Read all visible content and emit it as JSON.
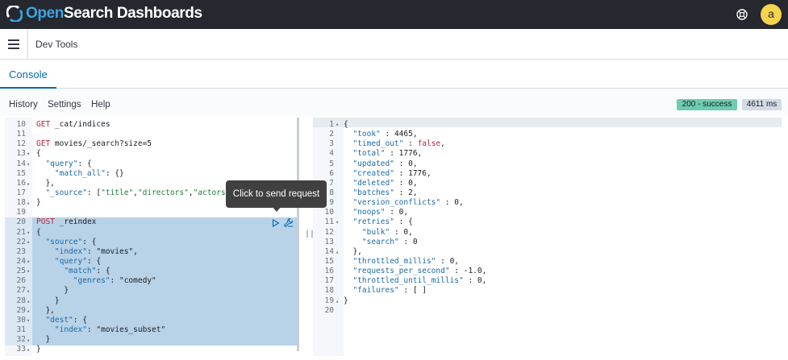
{
  "app": {
    "logo_open": "Open",
    "logo_rest": "Search Dashboards",
    "avatar_letter": "a",
    "help_icon": "help-ring-icon",
    "colors": {
      "topbar": "#25282f",
      "brand_blue": "#3ba4df",
      "avatar": "#f6d44d",
      "accent": "#006bb4"
    }
  },
  "subheader": {
    "breadcrumb": "Dev Tools"
  },
  "tabs": [
    {
      "label": "Console",
      "active": true
    }
  ],
  "menu": [
    "History",
    "Settings",
    "Help"
  ],
  "status": {
    "code_text": "200 - success",
    "time_text": "4611 ms",
    "success_color": "#6dccb1"
  },
  "tooltip": {
    "text": "Click to send request"
  },
  "request_lines": [
    {
      "n": "10",
      "f": "",
      "t": "GET _cat/indices"
    },
    {
      "n": "11",
      "f": "",
      "t": ""
    },
    {
      "n": "12",
      "f": "",
      "t": "GET movies/_search?size=5"
    },
    {
      "n": "13",
      "f": "▾",
      "t": "{"
    },
    {
      "n": "14",
      "f": "▾",
      "t": "  \"query\": {"
    },
    {
      "n": "15",
      "f": "",
      "t": "    \"match_all\": {}"
    },
    {
      "n": "16",
      "f": "▴",
      "t": "  },"
    },
    {
      "n": "17",
      "f": "",
      "t": "  \"_source\": [\"title\",\"directors\",\"actors\""
    },
    {
      "n": "18",
      "f": "▴",
      "t": "}"
    },
    {
      "n": "19",
      "f": "",
      "t": ""
    },
    {
      "n": "20",
      "f": "",
      "t": "POST _reindex"
    },
    {
      "n": "21",
      "f": "▾",
      "t": "{"
    },
    {
      "n": "22",
      "f": "▾",
      "t": "  \"source\": {"
    },
    {
      "n": "23",
      "f": "",
      "t": "    \"index\": \"movies\","
    },
    {
      "n": "24",
      "f": "▾",
      "t": "    \"query\": {"
    },
    {
      "n": "25",
      "f": "▾",
      "t": "      \"match\": {"
    },
    {
      "n": "26",
      "f": "",
      "t": "        \"genres\": \"comedy\""
    },
    {
      "n": "27",
      "f": "▴",
      "t": "      }"
    },
    {
      "n": "28",
      "f": "▴",
      "t": "    }"
    },
    {
      "n": "29",
      "f": "▴",
      "t": "  },"
    },
    {
      "n": "30",
      "f": "▾",
      "t": "  \"dest\": {"
    },
    {
      "n": "31",
      "f": "",
      "t": "    \"index\": \"movies_subset\""
    },
    {
      "n": "32",
      "f": "▴",
      "t": "  }"
    },
    {
      "n": "33",
      "f": "▴",
      "t": "}"
    }
  ],
  "response_lines": [
    {
      "n": "1",
      "f": "▾",
      "t": "{"
    },
    {
      "n": "2",
      "f": "",
      "t": "  \"took\" : 4465,"
    },
    {
      "n": "3",
      "f": "",
      "t": "  \"timed_out\" : false,"
    },
    {
      "n": "4",
      "f": "",
      "t": "  \"total\" : 1776,"
    },
    {
      "n": "5",
      "f": "",
      "t": "  \"updated\" : 0,"
    },
    {
      "n": "6",
      "f": "",
      "t": "  \"created\" : 1776,"
    },
    {
      "n": "7",
      "f": "",
      "t": "  \"deleted\" : 0,"
    },
    {
      "n": "8",
      "f": "",
      "t": "  \"batches\" : 2,"
    },
    {
      "n": "9",
      "f": "",
      "t": "  \"version_conflicts\" : 0,"
    },
    {
      "n": "10",
      "f": "",
      "t": "  \"noops\" : 0,"
    },
    {
      "n": "11",
      "f": "▾",
      "t": "  \"retries\" : {"
    },
    {
      "n": "12",
      "f": "",
      "t": "    \"bulk\" : 0,"
    },
    {
      "n": "13",
      "f": "",
      "t": "    \"search\" : 0"
    },
    {
      "n": "14",
      "f": "▴",
      "t": "  },"
    },
    {
      "n": "15",
      "f": "",
      "t": "  \"throttled_millis\" : 0,"
    },
    {
      "n": "16",
      "f": "",
      "t": "  \"requests_per_second\" : -1.0,"
    },
    {
      "n": "17",
      "f": "",
      "t": "  \"throttled_until_millis\" : 0,"
    },
    {
      "n": "18",
      "f": "",
      "t": "  \"failures\" : [ ]"
    },
    {
      "n": "19",
      "f": "▴",
      "t": "}"
    },
    {
      "n": "20",
      "f": "",
      "t": ""
    }
  ]
}
